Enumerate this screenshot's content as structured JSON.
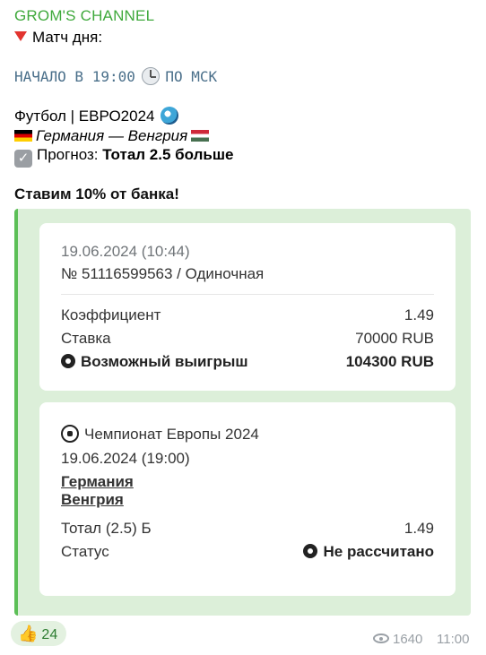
{
  "channel": {
    "name": "GROM'S CHANNEL"
  },
  "post": {
    "headline": "Матч дня:",
    "start_time_text": "НАЧАЛО В 19:00",
    "start_time_suffix": "ПО МСК",
    "sport_line": "Футбол | ЕВРО2024",
    "teams_line": "Германия — Венгрия",
    "prediction_label": "Прогноз: ",
    "prediction_value": "Тотал 2.5 больше",
    "stake_note": "Ставим 10% от банка!"
  },
  "bet_card": {
    "datetime": "19.06.2024 (10:44)",
    "ticket": "№ 51116599563 / Одиночная",
    "rows": [
      {
        "label": "Коэффициент",
        "value": "1.49"
      },
      {
        "label": "Ставка",
        "value": "70000 RUB"
      }
    ],
    "win_label": "Возможный выигрыш",
    "win_value": "104300 RUB"
  },
  "event_card": {
    "tournament": "Чемпионат Европы 2024",
    "datetime": "19.06.2024 (19:00)",
    "team1": "Германия",
    "team2": "Венгрия",
    "market_label": "Тотал (2.5) Б",
    "market_odds": "1.49",
    "status_label": "Статус",
    "status_value": "Не рассчитано"
  },
  "footer": {
    "reaction_count": "24",
    "views": "1640",
    "time": "11:00"
  },
  "colors": {
    "channel_name": "#3fa93c",
    "embed_bar": "#5cbf57",
    "embed_bg": "#dcefd9"
  }
}
